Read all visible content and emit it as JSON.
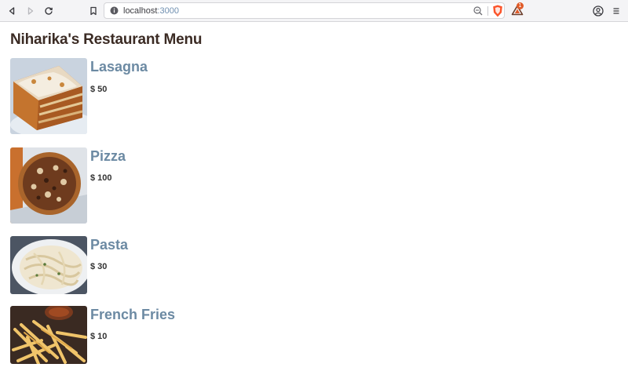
{
  "browser": {
    "url_host": "localhost",
    "url_port": ":3000",
    "rewards_count": "1"
  },
  "page": {
    "title": "Niharika's Restaurant Menu"
  },
  "menu": [
    {
      "name": "Lasagna",
      "price": "$ 50"
    },
    {
      "name": "Pizza",
      "price": "$ 100"
    },
    {
      "name": "Pasta",
      "price": "$ 30"
    },
    {
      "name": "French Fries",
      "price": "$ 10"
    }
  ],
  "colors": {
    "title": "#3b2b24",
    "item_name": "#6c8aa3",
    "price": "#333333",
    "brave_orange": "#fb542b"
  }
}
